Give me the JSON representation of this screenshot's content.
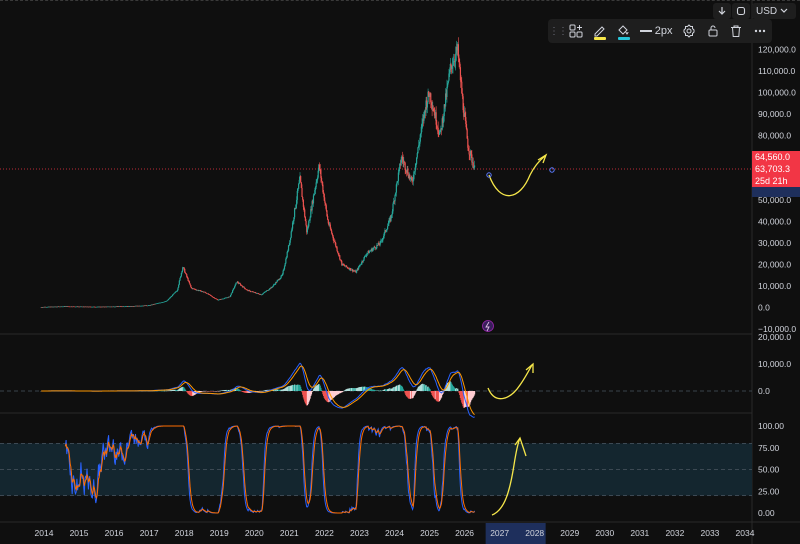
{
  "toolbar": {
    "stroke_width_label": "2px",
    "pencil_color": "#f5e64a",
    "fill_color": "#26c6da",
    "icons": [
      "drag-grip-icon",
      "template-icon",
      "pencil-icon",
      "fill-bucket-icon",
      "line-width-icon",
      "settings-gear-icon",
      "lock-icon",
      "trash-icon",
      "more-dots-icon"
    ]
  },
  "top_controls": {
    "currency": "USD",
    "arrow_icon": "down-arrow-icon",
    "refresh_icon": "refresh-icon"
  },
  "colors": {
    "up": "#26a69a",
    "down": "#ef5350",
    "macd_line": "#2962ff",
    "signal_line": "#ff9800",
    "stoch_k": "#2962ff",
    "stoch_d": "#ff6d00",
    "drawing": "#f5e64a",
    "band": "#14262f",
    "price_label_bg": "#f23645",
    "countdown_bg": "#1e2f5c"
  },
  "price_labels": {
    "high": "64,560.0",
    "last": "63,703.3",
    "countdown": "25d 21h"
  },
  "chart_data": [
    {
      "type": "candlestick",
      "title": "",
      "x_labels": [
        "2014",
        "2015",
        "2016",
        "2017",
        "2018",
        "2019",
        "2020",
        "2021",
        "2022",
        "2023",
        "2024",
        "2025",
        "2026",
        "2027",
        "2028",
        "2029",
        "2030",
        "2031",
        "2032",
        "2033",
        "2034"
      ],
      "highlighted_x_label": "2027",
      "y_ticks": [
        "120,000.0",
        "110,000.0",
        "100,000.0",
        "90,000.0",
        "80,000.0",
        "70,000.0",
        "50,000.0",
        "40,000.0",
        "30,000.0",
        "20,000.0",
        "10,000.0",
        "0.0",
        "−10,000.0"
      ],
      "ylim": [
        -10000,
        122000
      ],
      "series_points": [
        [
          2013.9,
          200
        ],
        [
          2014.6,
          500
        ],
        [
          2015.5,
          300
        ],
        [
          2016.5,
          600
        ],
        [
          2017.0,
          1000
        ],
        [
          2017.5,
          3000
        ],
        [
          2017.8,
          8000
        ],
        [
          2017.96,
          19000
        ],
        [
          2018.2,
          9000
        ],
        [
          2018.6,
          7000
        ],
        [
          2018.96,
          3500
        ],
        [
          2019.3,
          5000
        ],
        [
          2019.5,
          12000
        ],
        [
          2019.8,
          8000
        ],
        [
          2020.2,
          6000
        ],
        [
          2020.5,
          9500
        ],
        [
          2020.8,
          15000
        ],
        [
          2021.0,
          30000
        ],
        [
          2021.3,
          60000
        ],
        [
          2021.5,
          35000
        ],
        [
          2021.85,
          66000
        ],
        [
          2022.1,
          40000
        ],
        [
          2022.5,
          20000
        ],
        [
          2022.9,
          16500
        ],
        [
          2023.2,
          25000
        ],
        [
          2023.6,
          30000
        ],
        [
          2023.9,
          42000
        ],
        [
          2024.2,
          70000
        ],
        [
          2024.5,
          58000
        ],
        [
          2024.9,
          95000
        ],
        [
          2025.0,
          100000
        ],
        [
          2025.3,
          80000
        ],
        [
          2025.6,
          112000
        ],
        [
          2025.8,
          120000
        ],
        [
          2025.95,
          95000
        ],
        [
          2026.1,
          75000
        ],
        [
          2026.3,
          63703
        ]
      ]
    },
    {
      "type": "line",
      "title": "",
      "y_ticks": [
        "20,000.0",
        "10,000.0",
        "0.0"
      ],
      "ylim": [
        -8000,
        21000
      ]
    },
    {
      "type": "line",
      "title": "",
      "y_ticks": [
        "100.00",
        "75.00",
        "50.00",
        "25.00",
        "0.00"
      ],
      "ylim": [
        -2,
        105
      ]
    }
  ]
}
